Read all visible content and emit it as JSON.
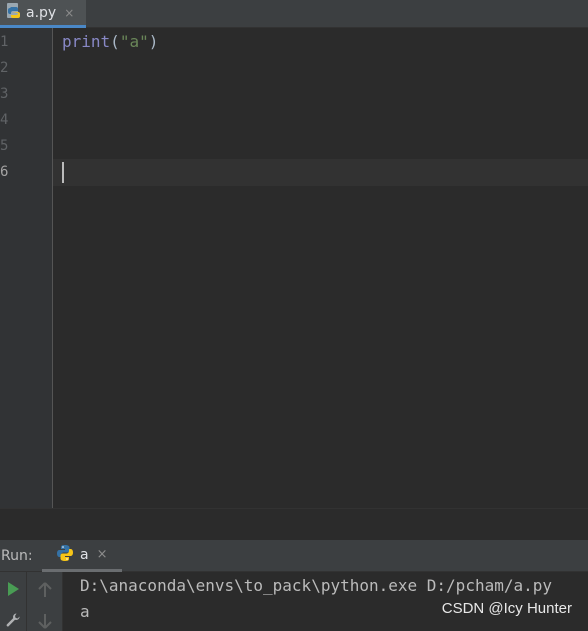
{
  "editor_tab": {
    "filename": "a.py",
    "icon": "python-file-icon",
    "close_glyph": "×"
  },
  "editor": {
    "line_numbers": [
      "1",
      "2",
      "3",
      "4",
      "5",
      "6"
    ],
    "current_line": 6,
    "code": {
      "line1_fn": "print",
      "line1_open": "(",
      "line1_str": "\"a\"",
      "line1_close": ")"
    }
  },
  "run_panel": {
    "title": "Run:",
    "tab_label": "a",
    "tab_icon": "python-icon",
    "close_glyph": "×",
    "console_lines": [
      "D:\\anaconda\\envs\\to_pack\\python.exe D:/pcham/a.py",
      "a"
    ]
  },
  "watermark": "CSDN @Icy Hunter",
  "colors": {
    "background": "#2b2b2b",
    "gutter": "#313335",
    "tab_active": "#4e5254",
    "accent": "#4a88c7",
    "run_green": "#499c54",
    "string_green": "#6a8759",
    "builtin_purple": "#8888c6"
  }
}
